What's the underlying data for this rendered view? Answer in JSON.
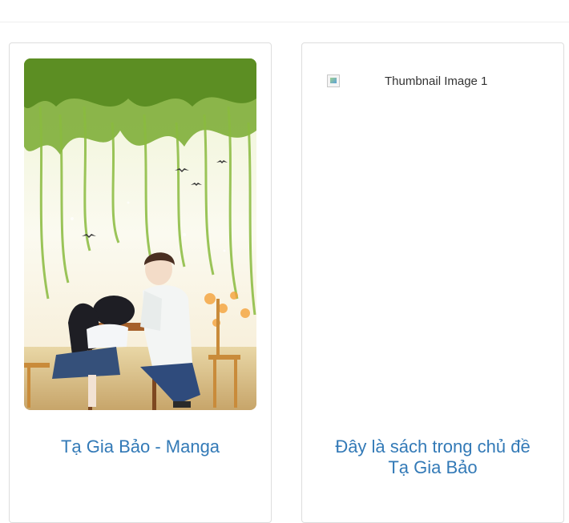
{
  "cards": [
    {
      "image": {
        "kind": "illustration",
        "description_icon": "manga-cover-image"
      },
      "title": "Tạ Gia Bảo - Manga"
    },
    {
      "image": {
        "kind": "broken",
        "alt": "Thumbnail Image 1"
      },
      "title_line1": "Đây là sách trong chủ đề",
      "title_line2": "Tạ Gia Bảo"
    }
  ],
  "colors": {
    "link": "#337ab7",
    "border": "#dddddd",
    "rule": "#eeeeee"
  }
}
